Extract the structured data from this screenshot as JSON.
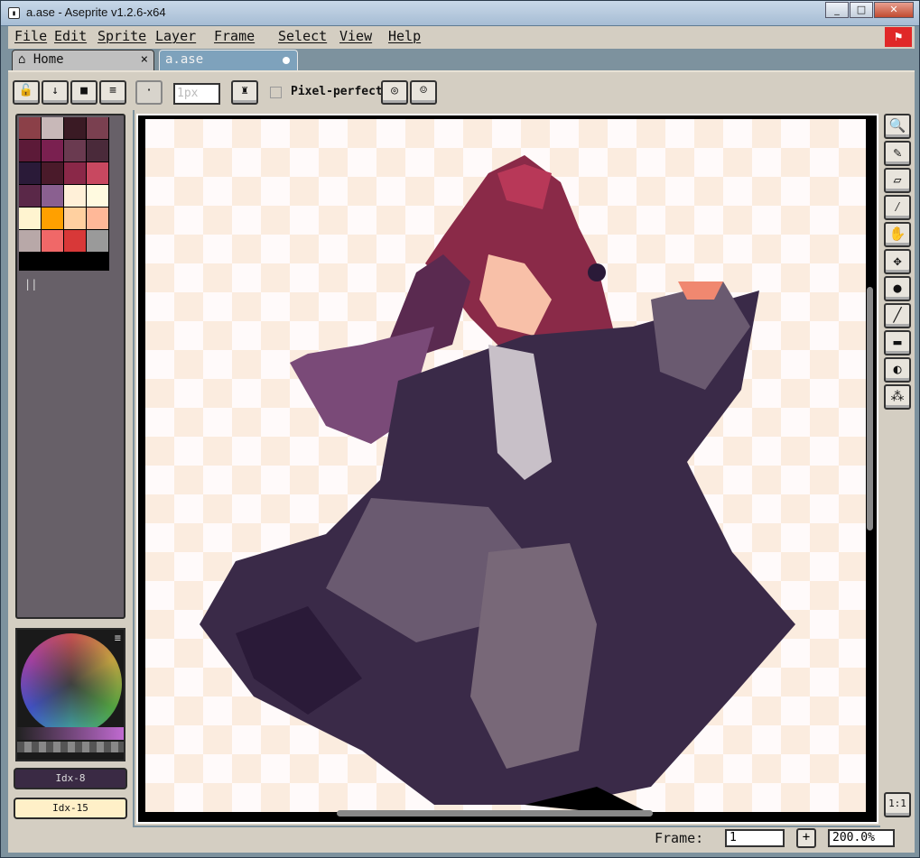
{
  "window": {
    "title": "a.ase - Aseprite v1.2.6-x64",
    "icon": "aseprite-app-icon"
  },
  "menu": [
    "File",
    "Edit",
    "Sprite",
    "Layer",
    "Frame",
    "Select",
    "View",
    "Help"
  ],
  "tabs": [
    {
      "label": "Home",
      "icon": "home-icon",
      "close": "×"
    },
    {
      "label": "a.ase",
      "modified": true
    }
  ],
  "toolbar": {
    "buttons": [
      "lock-icon",
      "down-arrow-icon",
      "square-icon",
      "menu-lines-icon"
    ],
    "brush_size_placeholder": "1px",
    "pixel_perfect_label": "Pixel-perfect",
    "pixel_perfect_checked": false
  },
  "palette": {
    "colors": [
      "#8b4048",
      "#c8b8b8",
      "#3a1a24",
      "#7a4050",
      "#5c1a38",
      "#7a2050",
      "#6a3a50",
      "#4a2a3a",
      "#2a1a38",
      "#4a1a2a",
      "#8a2848",
      "#c84860",
      "#5a2848",
      "#8a6090",
      "#fff0d8",
      "#fffae0",
      "#fff4d0",
      "#ffa000",
      "#ffd0a0",
      "#ffb898",
      "#b8a8a8",
      "#f06868",
      "#d83838",
      "#9a9a9a"
    ]
  },
  "color_selector": {
    "index_fg": "Idx-8",
    "index_bg": "Idx-15",
    "fg_color": "#3a2a44",
    "bg_color": "#fff0c8"
  },
  "tools": [
    "zoom-icon",
    "pencil-icon",
    "eraser-icon",
    "eyedropper-icon",
    "hand-icon",
    "move-icon",
    "paint-bucket-icon",
    "line-icon",
    "rectangle-icon",
    "blur-icon",
    "spray-icon"
  ],
  "status": {
    "frame_label": "Frame:",
    "frame_value": "1",
    "add_frame": "+",
    "zoom": "200.0%",
    "fit_button": "1:1"
  }
}
